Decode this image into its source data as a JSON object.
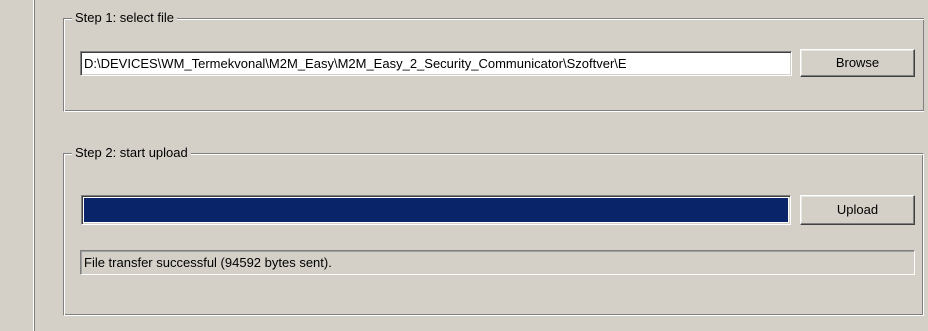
{
  "step1": {
    "title": "Step 1: select file",
    "file_path": "D:\\DEVICES\\WM_Termekvonal\\M2M_Easy\\M2M_Easy_2_Security_Communicator\\Szoftver\\E",
    "browse_label": "Browse"
  },
  "step2": {
    "title": "Step 2: start upload",
    "progress_percent": 100,
    "progress_color": "#0a246a",
    "upload_label": "Upload",
    "status_text": "File transfer successful (94592 bytes sent)."
  }
}
